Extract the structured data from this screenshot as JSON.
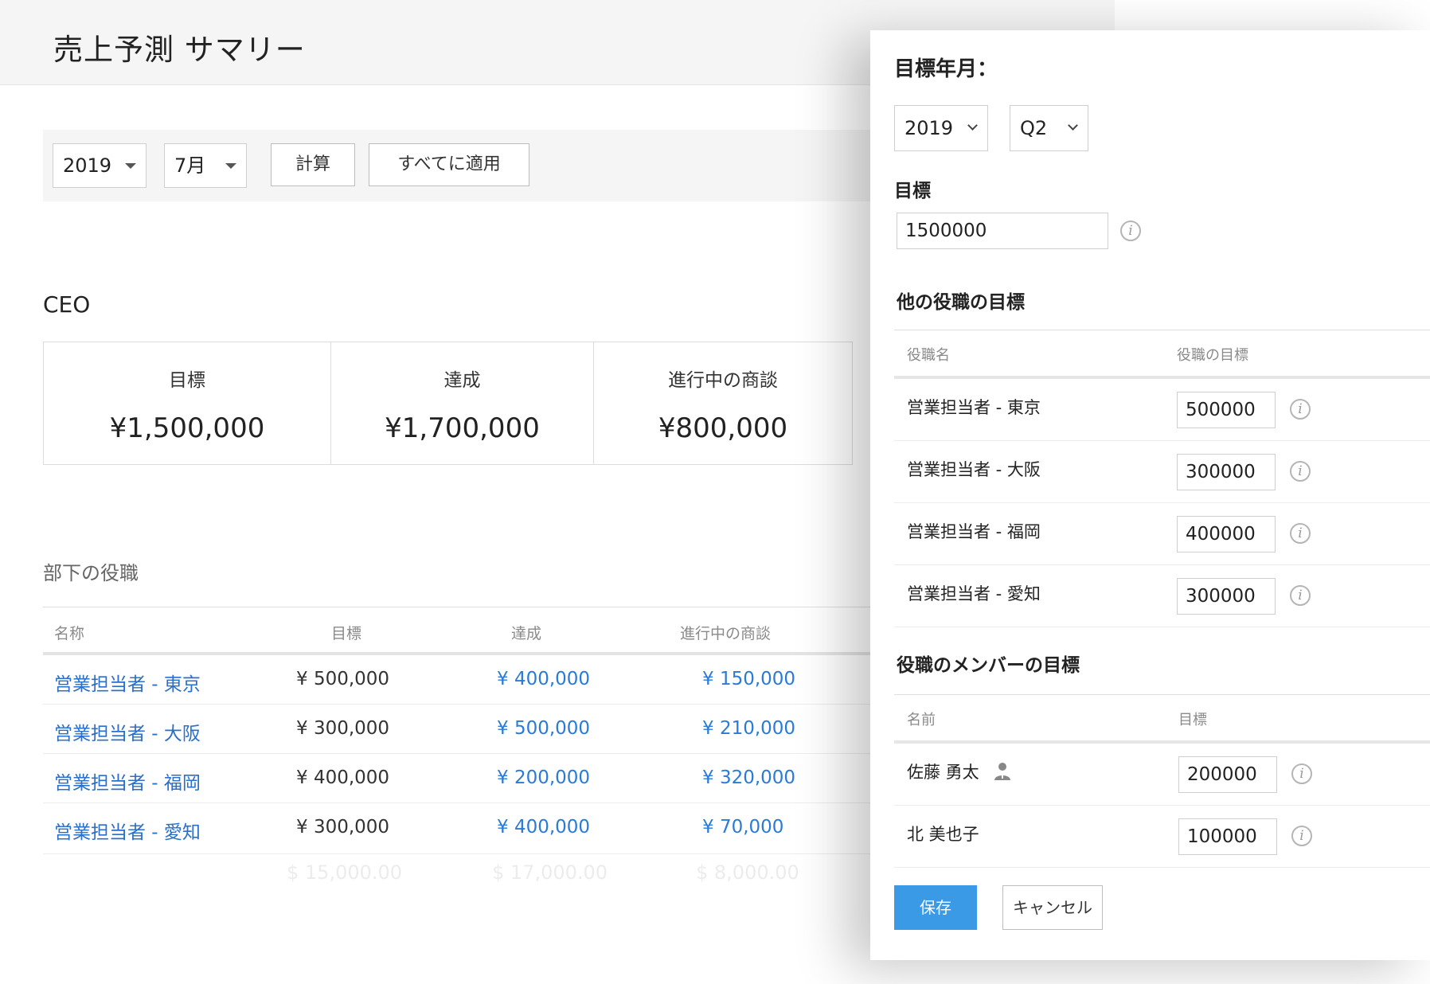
{
  "page": {
    "title": "売上予測 サマリー",
    "toolbar": {
      "year": "2019",
      "month": "7月",
      "calculate_label": "計算",
      "apply_all_label": "すべてに適用"
    },
    "ceo": {
      "label": "CEO",
      "stats": [
        {
          "label": "目標",
          "value": "¥1,500,000"
        },
        {
          "label": "達成",
          "value": "¥1,700,000"
        },
        {
          "label": "進行中の商談",
          "value": "¥800,000"
        }
      ]
    },
    "subordinates": {
      "label": "部下の役職",
      "headers": [
        "名称",
        "目標",
        "達成",
        "進行中の商談"
      ],
      "rows": [
        {
          "name": "営業担当者 - 東京",
          "target": "¥ 500,000",
          "achieved": "¥ 400,000",
          "deals": "¥ 150,000"
        },
        {
          "name": "営業担当者 - 大阪",
          "target": "¥ 300,000",
          "achieved": "¥ 500,000",
          "deals": "¥ 210,000"
        },
        {
          "name": "営業担当者 - 福岡",
          "target": "¥ 400,000",
          "achieved": "¥ 200,000",
          "deals": "¥ 320,000"
        },
        {
          "name": "営業担当者 - 愛知",
          "target": "¥ 300,000",
          "achieved": "¥ 400,000",
          "deals": "¥ 70,000"
        }
      ],
      "ghost_row": [
        "$ 15,000.00",
        "$ 17,000.00",
        "$ 8,000.00"
      ]
    }
  },
  "dialog": {
    "period_label": "目標年月：",
    "year": "2019",
    "quarter": "Q2",
    "target_label": "目標",
    "target_value": "1500000",
    "other_roles": {
      "label": "他の役職の目標",
      "headers": [
        "役職名",
        "役職の目標"
      ],
      "rows": [
        {
          "name": "営業担当者 - 東京",
          "value": "500000"
        },
        {
          "name": "営業担当者 - 大阪",
          "value": "300000"
        },
        {
          "name": "営業担当者 - 福岡",
          "value": "400000"
        },
        {
          "name": "営業担当者 - 愛知",
          "value": "300000"
        }
      ]
    },
    "members": {
      "label": "役職のメンバーの目標",
      "headers": [
        "名前",
        "目標"
      ],
      "rows": [
        {
          "name": "佐藤 勇太",
          "value": "200000",
          "icon": "user-icon"
        },
        {
          "name": "北 美也子",
          "value": "100000"
        }
      ]
    },
    "save_label": "保存",
    "cancel_label": "キャンセル",
    "info_glyph": "i"
  }
}
